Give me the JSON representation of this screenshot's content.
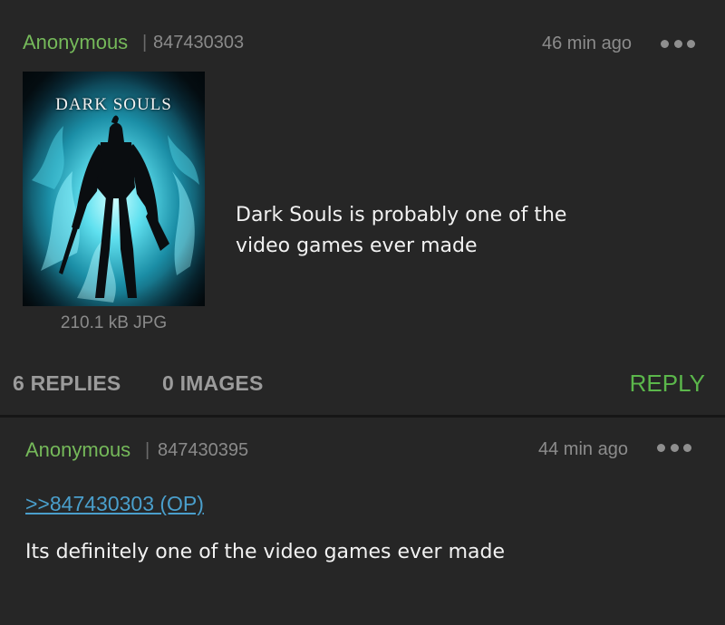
{
  "op_post": {
    "name": "Anonymous",
    "separator": "|",
    "post_number": "847430303",
    "time_ago": "46 min ago",
    "menu_icon": "more-horizontal-icon",
    "image": {
      "title_text": "DARK SOULS",
      "file_info": "210.1 kB JPG"
    },
    "comment": "Dark Souls is probably one of the\nvideo games ever made",
    "replies_label": "6 REPLIES",
    "images_label": "0 IMAGES",
    "reply_label": "REPLY"
  },
  "reply_post": {
    "name": "Anonymous",
    "separator": "|",
    "post_number": "847430395",
    "time_ago": "44 min ago",
    "menu_icon": "more-horizontal-icon",
    "quote_link": ">>847430303 (OP)",
    "comment": "Its definitely one of the video games ever made"
  },
  "colors": {
    "background": "#262626",
    "name": "#75b95a",
    "reply_button": "#5bb74b",
    "quote_link": "#4a9fcc",
    "muted_text": "#8a8a8a"
  }
}
